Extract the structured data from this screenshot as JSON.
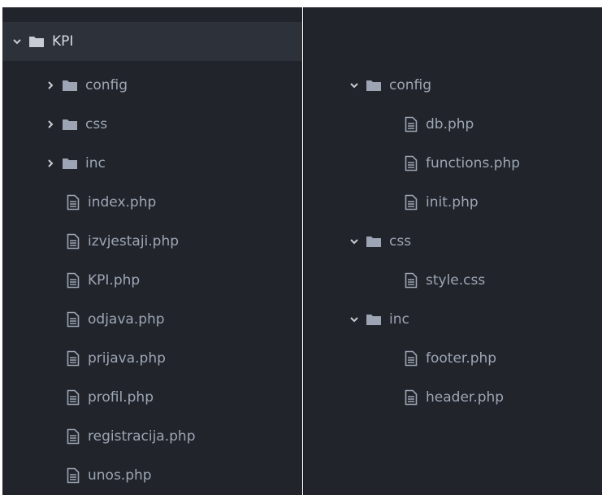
{
  "left_tree": {
    "root": {
      "label": "KPI",
      "expanded": true,
      "icon": "folder-icon"
    },
    "folders": [
      {
        "label": "config",
        "expanded": false
      },
      {
        "label": "css",
        "expanded": false
      },
      {
        "label": "inc",
        "expanded": false
      }
    ],
    "files": [
      {
        "label": "index.php"
      },
      {
        "label": "izvjestaji.php"
      },
      {
        "label": "KPI.php"
      },
      {
        "label": "odjava.php"
      },
      {
        "label": "prijava.php"
      },
      {
        "label": "profil.php"
      },
      {
        "label": "registracija.php"
      },
      {
        "label": "unos.php"
      }
    ]
  },
  "right_tree": {
    "folders": [
      {
        "label": "config",
        "expanded": true,
        "files": [
          "db.php",
          "functions.php",
          "init.php"
        ]
      },
      {
        "label": "css",
        "expanded": true,
        "files": [
          "style.css"
        ]
      },
      {
        "label": "inc",
        "expanded": true,
        "files": [
          "footer.php",
          "header.php"
        ]
      }
    ]
  },
  "colors": {
    "panel_bg": "#21252b",
    "selected_bg": "#2c313a",
    "text": "#9da5b4",
    "icon": "#9da5b4"
  }
}
